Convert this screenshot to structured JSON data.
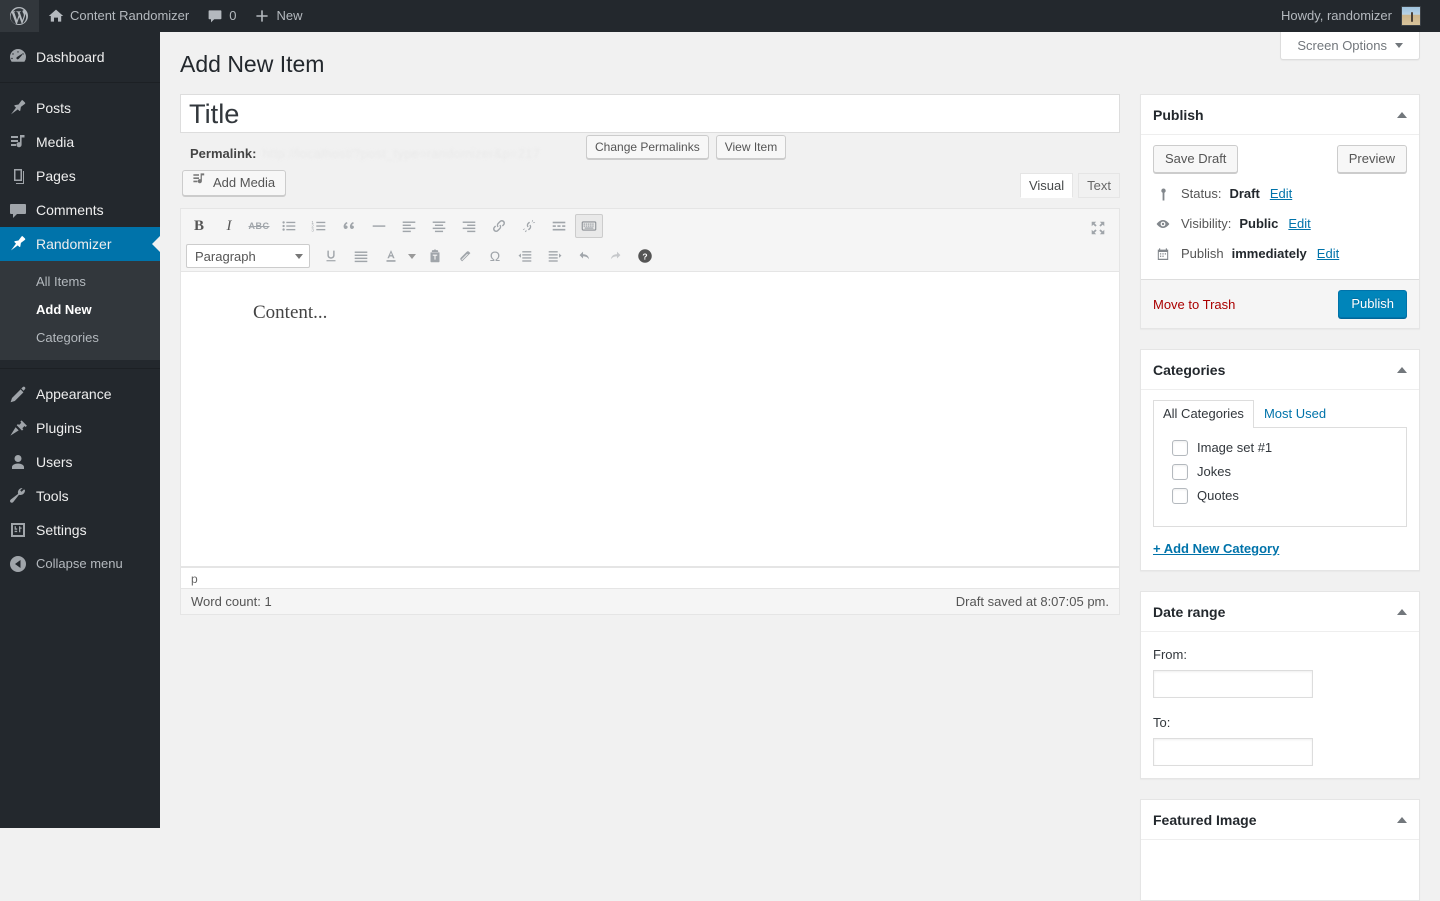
{
  "adminbar": {
    "wp_logo": "wordpress-logo",
    "site_name": "Content Randomizer",
    "comments_count": "0",
    "new_label": "New",
    "howdy": "Howdy, randomizer"
  },
  "sidebar": {
    "items": [
      {
        "label": "Dashboard",
        "icon": "dashboard-icon",
        "current": false
      },
      {
        "label": "Posts",
        "icon": "pin-icon",
        "current": false
      },
      {
        "label": "Media",
        "icon": "media-icon",
        "current": false
      },
      {
        "label": "Pages",
        "icon": "pages-icon",
        "current": false
      },
      {
        "label": "Comments",
        "icon": "comments-icon",
        "current": false
      },
      {
        "label": "Randomizer",
        "icon": "pin-icon",
        "current": true
      },
      {
        "label": "Appearance",
        "icon": "brush-icon",
        "current": false
      },
      {
        "label": "Plugins",
        "icon": "plug-icon",
        "current": false
      },
      {
        "label": "Users",
        "icon": "user-icon",
        "current": false
      },
      {
        "label": "Tools",
        "icon": "wrench-icon",
        "current": false
      },
      {
        "label": "Settings",
        "icon": "settings-icon",
        "current": false
      }
    ],
    "submenu": [
      {
        "label": "All Items",
        "current": false
      },
      {
        "label": "Add New",
        "current": true
      },
      {
        "label": "Categories",
        "current": false
      }
    ],
    "collapse_label": "Collapse menu"
  },
  "screen_options": {
    "label": "Screen Options"
  },
  "page": {
    "title": "Add New Item"
  },
  "title_field": {
    "placeholder": "Title",
    "value": ""
  },
  "permalink": {
    "label": "Permalink:",
    "url": "http://localhost/?post_type=randomizer&p=217",
    "change_button": "Change Permalinks",
    "view_button": "View Item"
  },
  "editor": {
    "add_media": "Add Media",
    "tab_visual": "Visual",
    "tab_text": "Text",
    "format_select": "Paragraph",
    "content_placeholder": "Content...",
    "path": "p",
    "word_count": "Word count: 1",
    "draft_saved": "Draft saved at 8:07:05 pm.",
    "toolbar_row1": [
      {
        "name": "bold-icon",
        "glyph": "B"
      },
      {
        "name": "italic-icon",
        "glyph": "I"
      },
      {
        "name": "strikethrough-icon",
        "glyph": "ABC"
      },
      {
        "name": "bullet-list-icon",
        "glyph": ""
      },
      {
        "name": "numbered-list-icon",
        "glyph": ""
      },
      {
        "name": "blockquote-icon",
        "glyph": ""
      },
      {
        "name": "horizontal-rule-icon",
        "glyph": ""
      },
      {
        "name": "align-left-icon",
        "glyph": ""
      },
      {
        "name": "align-center-icon",
        "glyph": ""
      },
      {
        "name": "align-right-icon",
        "glyph": ""
      },
      {
        "name": "link-icon",
        "glyph": ""
      },
      {
        "name": "unlink-icon",
        "glyph": ""
      },
      {
        "name": "read-more-icon",
        "glyph": ""
      },
      {
        "name": "kitchen-sink-icon",
        "glyph": ""
      }
    ],
    "toolbar_row2": [
      {
        "name": "underline-icon"
      },
      {
        "name": "justify-icon"
      },
      {
        "name": "text-color-icon"
      },
      {
        "name": "paste-as-text-icon"
      },
      {
        "name": "clear-formatting-icon"
      },
      {
        "name": "special-character-icon"
      },
      {
        "name": "outdent-icon"
      },
      {
        "name": "indent-icon"
      },
      {
        "name": "undo-icon"
      },
      {
        "name": "redo-icon"
      },
      {
        "name": "keyboard-shortcuts-icon"
      }
    ],
    "fullscreen_icon": "fullscreen-icon"
  },
  "publish_box": {
    "title": "Publish",
    "save_draft": "Save Draft",
    "preview": "Preview",
    "status_label": "Status:",
    "status_value": "Draft",
    "status_edit": "Edit",
    "visibility_label": "Visibility:",
    "visibility_value": "Public",
    "visibility_edit": "Edit",
    "publish_label": "Publish",
    "publish_value": "immediately",
    "publish_edit": "Edit",
    "trash": "Move to Trash",
    "publish_button": "Publish"
  },
  "categories_box": {
    "title": "Categories",
    "tab_all": "All Categories",
    "tab_most_used": "Most Used",
    "items": [
      {
        "label": "Image set #1",
        "checked": false
      },
      {
        "label": "Jokes",
        "checked": false
      },
      {
        "label": "Quotes",
        "checked": false
      }
    ],
    "add_new": "+ Add New Category"
  },
  "date_range_box": {
    "title": "Date range",
    "from_label": "From:",
    "from_value": "",
    "to_label": "To:",
    "to_value": ""
  },
  "featured_image_box": {
    "title": "Featured Image"
  },
  "colors": {
    "admin_bar": "#23282d",
    "sidebar": "#23282d",
    "submenu": "#32373c",
    "accent": "#0073aa",
    "primary_button": "#0085ba",
    "link": "#0073aa",
    "danger": "#a00",
    "page_bg": "#f1f1f1"
  }
}
